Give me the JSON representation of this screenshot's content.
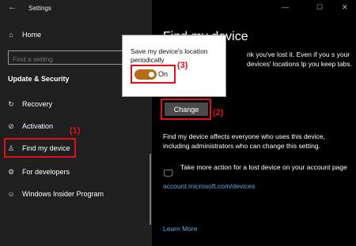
{
  "window": {
    "title": "Settings",
    "back_glyph": "←",
    "minimize_glyph": "—",
    "maximize_glyph": "☐",
    "close_glyph": "✕"
  },
  "sidebar": {
    "home_label": "Home",
    "search_placeholder": "Find a setting",
    "section_title": "Update & Security",
    "items": [
      {
        "label": "Recovery",
        "icon": "recovery-icon"
      },
      {
        "label": "Activation",
        "icon": "activation-icon"
      },
      {
        "label": "Find my device",
        "icon": "find-device-icon"
      },
      {
        "label": "For developers",
        "icon": "developers-icon"
      },
      {
        "label": "Windows Insider Program",
        "icon": "insider-icon"
      }
    ]
  },
  "main": {
    "page_title": "Find my device",
    "intro_text": "nk you've lost it. Even if you s your devices' locations lp you keep tabs.",
    "change_button": "Change",
    "description": "Find my device affects everyone who uses this device, including administrators who can change this setting.",
    "more_action_text": "Take more action for a lost device on your account page",
    "account_link": "account.microsoft.com/devices",
    "learn_more": "Learn More"
  },
  "popup": {
    "text": "Save my device's location periodically",
    "toggle_state": "On",
    "toggle_on": true
  },
  "annotations": {
    "step1": "(1)",
    "step2": "(2)",
    "step3": "(3)",
    "color": "#e0101a"
  },
  "colors": {
    "accent": "#b56d17",
    "link": "#63a7e6",
    "highlight": "#e0101a"
  }
}
